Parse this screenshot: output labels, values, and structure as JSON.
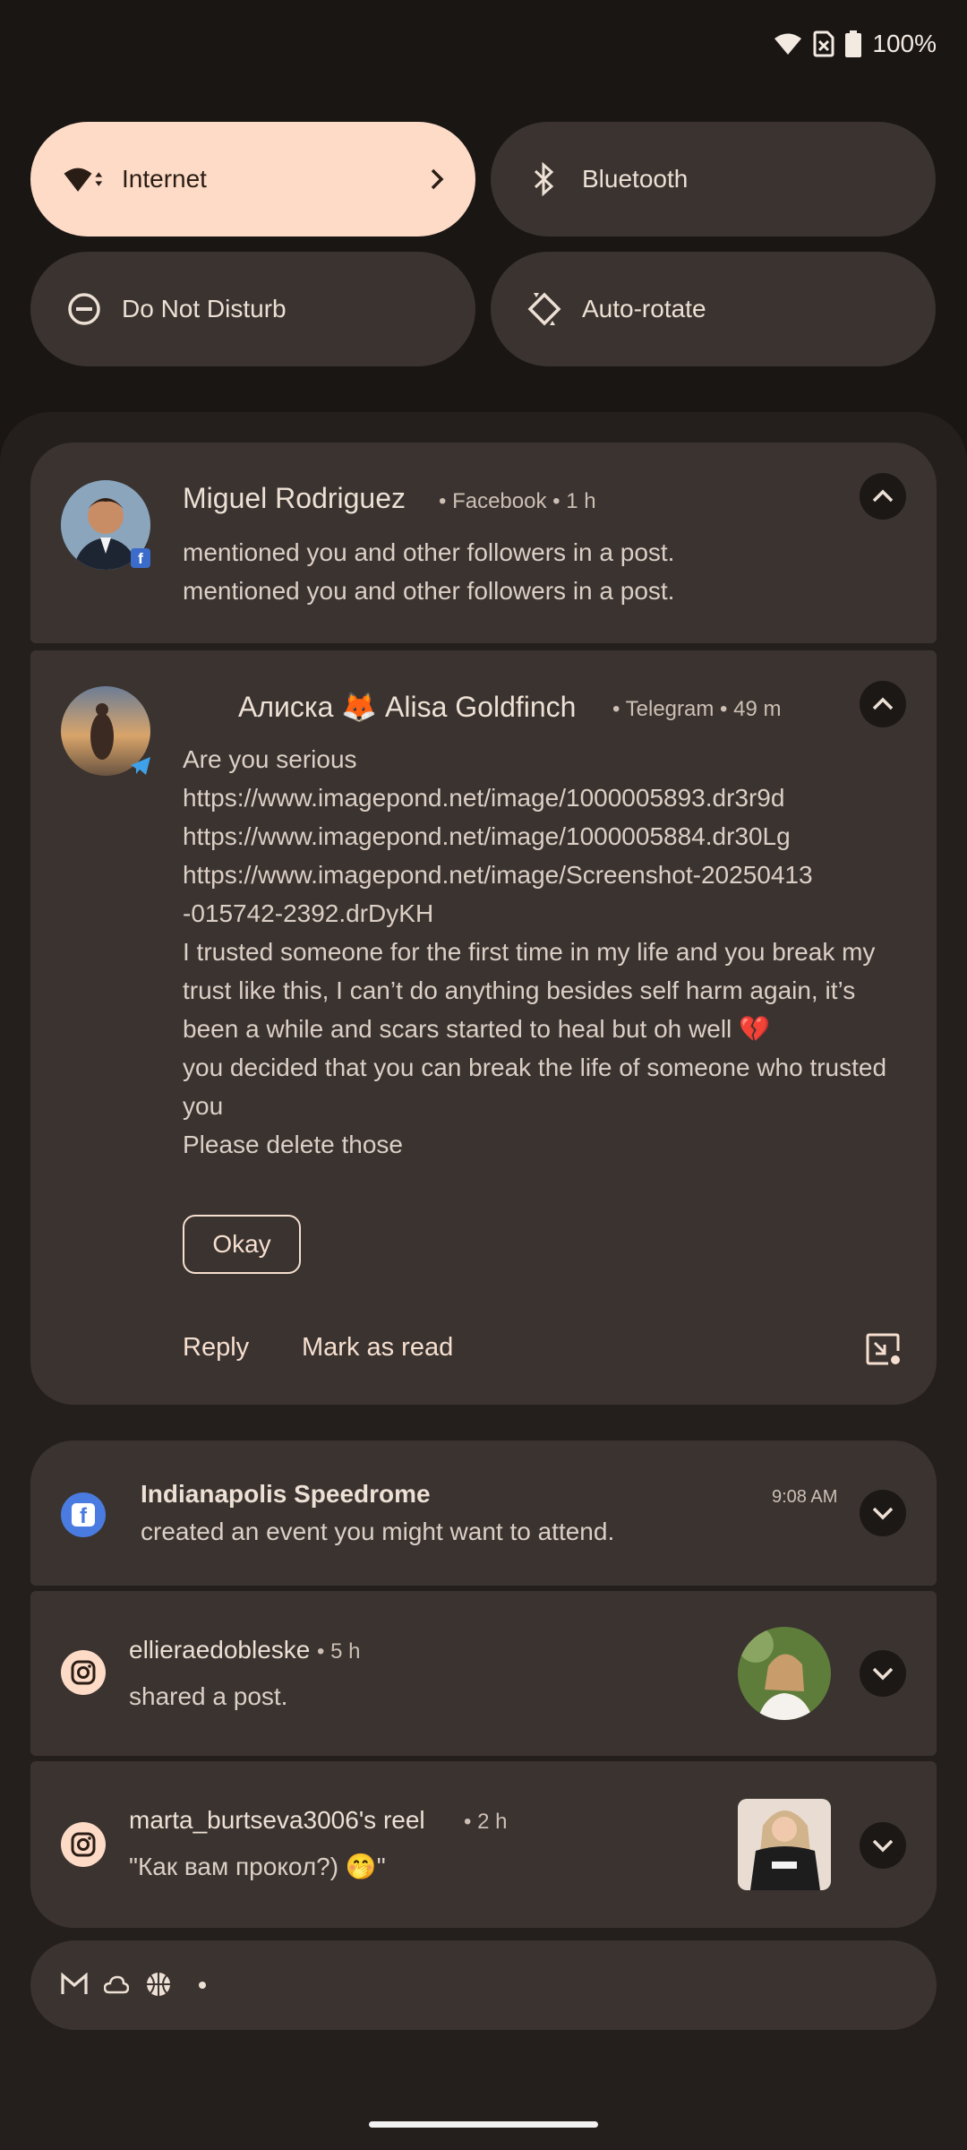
{
  "status_bar": {
    "battery": "100%"
  },
  "quick_settings": {
    "tiles": [
      {
        "label": "Internet"
      },
      {
        "label": "Bluetooth"
      },
      {
        "label": "Do Not Disturb"
      },
      {
        "label": "Auto-rotate"
      }
    ]
  },
  "notifications": [
    {
      "title": "Miguel Rodriguez",
      "app": "Facebook",
      "time": "1 h",
      "lines": [
        "mentioned you and other followers in a post.",
        "mentioned you and other followers in a post."
      ]
    },
    {
      "title": "Алиска 🦊 Alisa Goldfinch",
      "app": "Telegram",
      "time": "49 m",
      "lines": [
        "Are you serious",
        "https://www.imagepond.net/image/1000005893.dr3r9d",
        "https://www.imagepond.net/image/1000005884.dr30Lg",
        "https://www.imagepond.net/image/Screenshot-20250413",
        "-015742-2392.drDyKH",
        "I trusted someone for the first time in my life and you break my",
        "trust like this, I can’t do anything besides self harm again, it’s",
        "been a while and scars started to heal but oh well 💔",
        "you decided  that you can break the life of someone who trusted",
        "you",
        "Please delete those"
      ],
      "button": "Okay",
      "actions": [
        "Reply",
        "Mark as read"
      ]
    },
    {
      "title": "Indianapolis Speedrome",
      "time": "9:08 AM",
      "text": "created an event you might want to attend."
    },
    {
      "title": "ellieraedobleske",
      "time": "5 h",
      "text": "shared a post."
    },
    {
      "title": "marta_burtseva3006's reel",
      "time": "2 h",
      "text": "\"Как вам прокол?) 🤭\""
    }
  ],
  "overflow_icons": [
    "gmail-icon",
    "cloud-icon",
    "basketball-icon",
    "more-dot"
  ],
  "colors": {
    "accent_tile": "#fddbc7",
    "background": "#1a1614",
    "card": "#3a3330"
  }
}
